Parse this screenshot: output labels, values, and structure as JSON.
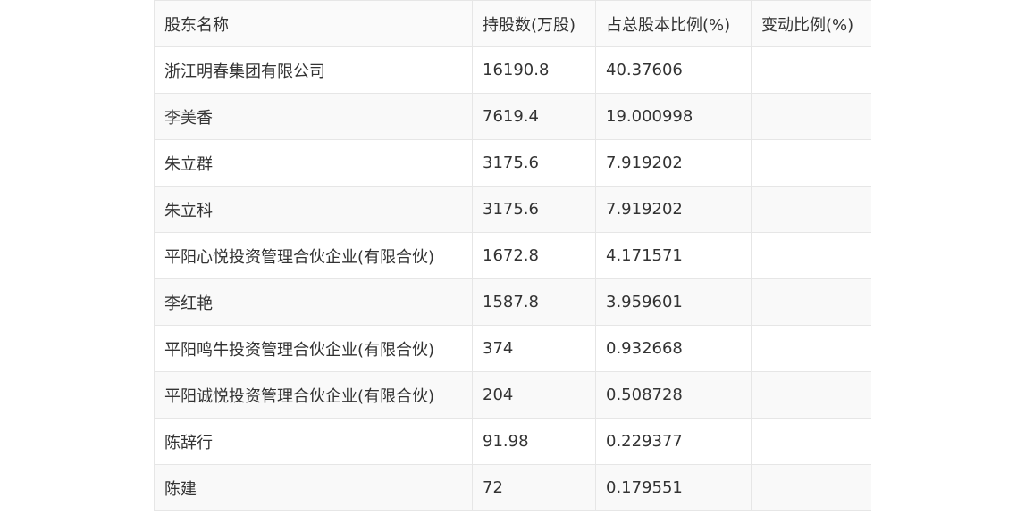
{
  "table": {
    "headers": [
      "股东名称",
      "持股数(万股)",
      "占总股本比例(%)",
      "变动比例(%)"
    ],
    "rows": [
      [
        "浙江明春集团有限公司",
        "16190.8",
        "40.37606",
        ""
      ],
      [
        "李美香",
        "7619.4",
        "19.000998",
        ""
      ],
      [
        "朱立群",
        "3175.6",
        "7.919202",
        ""
      ],
      [
        "朱立科",
        "3175.6",
        "7.919202",
        ""
      ],
      [
        "平阳心悦投资管理合伙企业(有限合伙)",
        "1672.8",
        "4.171571",
        ""
      ],
      [
        "李红艳",
        "1587.8",
        "3.959601",
        ""
      ],
      [
        "平阳鸣牛投资管理合伙企业(有限合伙)",
        "374",
        "0.932668",
        ""
      ],
      [
        "平阳诚悦投资管理合伙企业(有限合伙)",
        "204",
        "0.508728",
        ""
      ],
      [
        "陈辞行",
        "91.98",
        "0.229377",
        ""
      ],
      [
        "陈建",
        "72",
        "0.179551",
        ""
      ]
    ]
  }
}
